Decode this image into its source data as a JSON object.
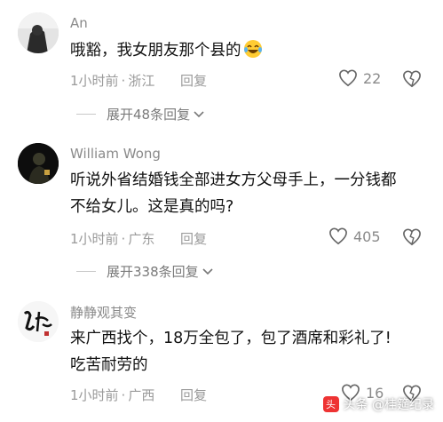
{
  "comments": [
    {
      "username": "An",
      "text_lines": [
        "哦豁，我女朋友那个县的"
      ],
      "emoji": "laughing-crying-emoji",
      "time": "1小时前",
      "location": "浙江",
      "reply_label": "回复",
      "likes": "22",
      "expand_label": "展开48条回复"
    },
    {
      "username": "William Wong",
      "text_lines": [
        "听说外省结婚钱全部进女方父母手上，一分钱都",
        "不给女儿。这是真的吗?"
      ],
      "time": "1小时前",
      "location": "广东",
      "reply_label": "回复",
      "likes": "405",
      "expand_label": "展开338条回复"
    },
    {
      "username": "静静观其变",
      "text_lines": [
        "来广西找个，18万全包了，包了酒席和彩礼了!",
        "吃苦耐劳的"
      ],
      "time": "1小时前",
      "location": "广西",
      "reply_label": "回复",
      "likes": "16"
    }
  ],
  "watermark": "头条 @桂筵纪录",
  "colors": {
    "text": "#111111",
    "meta": "#9a9a9a",
    "username": "#8a8a8a"
  }
}
